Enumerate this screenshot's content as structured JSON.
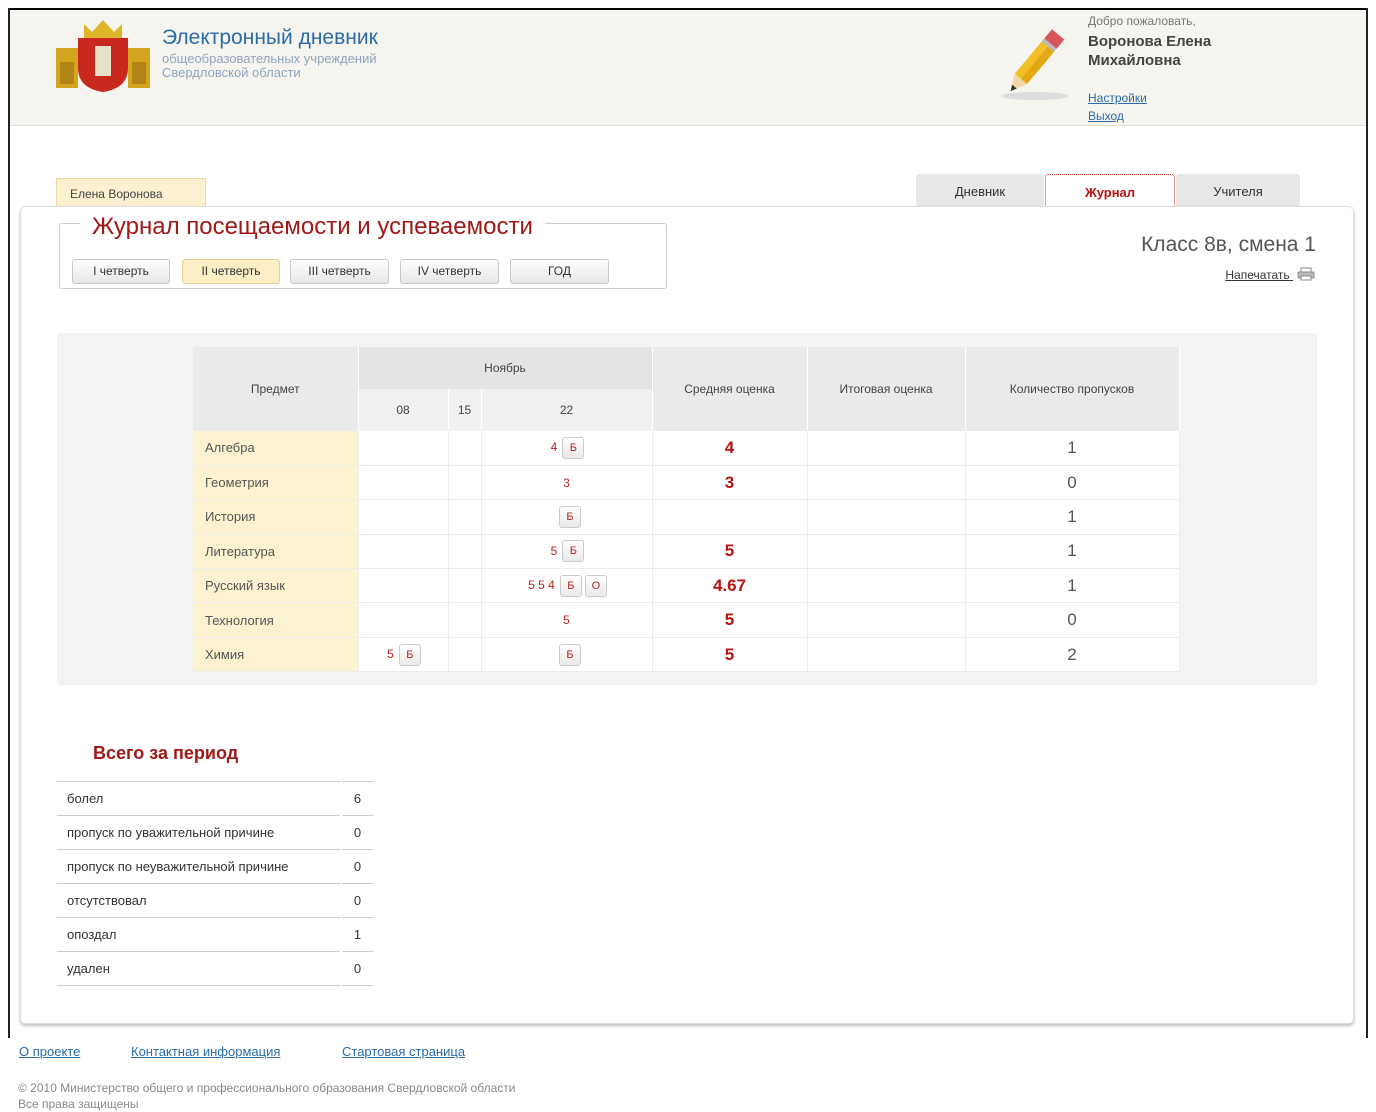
{
  "header": {
    "title": "Электронный дневник",
    "subtitle_line1": "общеобразовательных учреждений",
    "subtitle_line2": "Свердловской области",
    "welcome": "Добро пожаловать,",
    "user_line1": "Воронова Елена",
    "user_line2": "Михайловна",
    "settings_link": "Настройки",
    "logout_link": "Выход"
  },
  "student_tab": "Елена Воронова",
  "tabs": [
    {
      "label": "Дневник",
      "active": false
    },
    {
      "label": "Журнал",
      "active": true
    },
    {
      "label": "Учителя",
      "active": false
    }
  ],
  "journal": {
    "title": "Журнал посещаемости и успеваемости",
    "quarters": [
      "I четверть",
      "II четверть",
      "III четверть",
      "IV четверть",
      "ГОД"
    ],
    "active_quarter": 1,
    "class_info": "Класс 8в, смена 1",
    "print_label": "Напечатать"
  },
  "table": {
    "headers": {
      "subject": "Предмет",
      "month": "Ноябрь",
      "days": [
        "08",
        "15",
        "22"
      ],
      "avg": "Средняя оценка",
      "final": "Итоговая оценка",
      "absences": "Количество пропусков"
    },
    "rows": [
      {
        "subject": "Алгебра",
        "d08": "",
        "d15": "",
        "d22": "4",
        "d22_badges": [
          "Б"
        ],
        "d08_badges": [],
        "avg": "4",
        "final": "",
        "absences": "1"
      },
      {
        "subject": "Геометрия",
        "d08": "",
        "d15": "",
        "d22": "3",
        "d22_badges": [],
        "d08_badges": [],
        "avg": "3",
        "final": "",
        "absences": "0"
      },
      {
        "subject": "История",
        "d08": "",
        "d15": "",
        "d22": "",
        "d22_badges": [
          "Б"
        ],
        "d08_badges": [],
        "avg": "",
        "final": "",
        "absences": "1"
      },
      {
        "subject": "Литература",
        "d08": "",
        "d15": "",
        "d22": "5",
        "d22_badges": [
          "Б"
        ],
        "d08_badges": [],
        "avg": "5",
        "final": "",
        "absences": "1"
      },
      {
        "subject": "Русский язык",
        "d08": "",
        "d15": "",
        "d22": "5 5 4",
        "d22_badges": [
          "Б",
          "О"
        ],
        "d08_badges": [],
        "avg": "4.67",
        "final": "",
        "absences": "1"
      },
      {
        "subject": "Технология",
        "d08": "",
        "d15": "",
        "d22": "5",
        "d22_badges": [],
        "d08_badges": [],
        "avg": "5",
        "final": "",
        "absences": "0"
      },
      {
        "subject": "Химия",
        "d08": "5",
        "d15": "",
        "d22": "",
        "d22_badges": [
          "Б"
        ],
        "d08_badges": [
          "Б"
        ],
        "avg": "5",
        "final": "",
        "absences": "2"
      }
    ]
  },
  "period": {
    "title": "Всего за период",
    "rows": [
      {
        "label": "болел",
        "value": "6"
      },
      {
        "label": "пропуск по уважительной причине",
        "value": "0"
      },
      {
        "label": "пропуск по неуважительной причине",
        "value": "0"
      },
      {
        "label": "отсутствовал",
        "value": "0"
      },
      {
        "label": "опоздал",
        "value": "1"
      },
      {
        "label": "удален",
        "value": "0"
      }
    ]
  },
  "footer": {
    "links": [
      "О проекте",
      "Контактная информация",
      "Стартовая страница"
    ],
    "copyright": "© 2010 Министерство общего и профессионального образования Свердловской области",
    "rights": "Все права защищены"
  },
  "colors": {
    "accent_red": "#a01818",
    "link_blue": "#2a6ca8",
    "subject_bg": "#fdf2d0"
  },
  "icons": [
    "coat-of-arms-logo",
    "pencil-icon",
    "printer-icon"
  ]
}
